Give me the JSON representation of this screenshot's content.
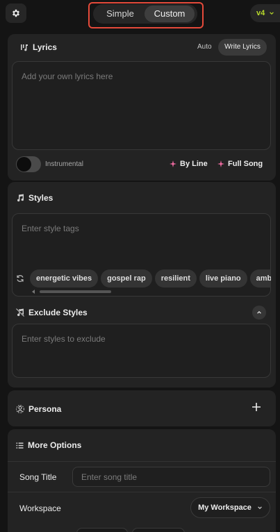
{
  "header": {
    "modes": [
      "Simple",
      "Custom"
    ],
    "active_mode": "Custom",
    "version": "v4"
  },
  "lyrics": {
    "title": "Lyrics",
    "auto_label": "Auto",
    "write_label": "Write Lyrics",
    "placeholder": "Add your own lyrics here",
    "instrumental_label": "Instrumental",
    "instrumental_on": false,
    "by_line_label": "By Line",
    "full_song_label": "Full Song"
  },
  "styles": {
    "title": "Styles",
    "placeholder": "Enter style tags",
    "tags": [
      "energetic vibes",
      "gospel rap",
      "resilient",
      "live piano",
      "ambient"
    ],
    "exclude_title": "Exclude Styles",
    "exclude_placeholder": "Enter styles to exclude"
  },
  "persona": {
    "title": "Persona"
  },
  "more_options": {
    "title": "More Options",
    "song_title_label": "Song Title",
    "song_title_placeholder": "Enter song title",
    "workspace_label": "Workspace",
    "workspace_value": "My Workspace"
  },
  "colors": {
    "accent_lime": "#b7d92b",
    "sparkle_pink": "#ef6aa0",
    "highlight_red": "#e54a3a"
  }
}
